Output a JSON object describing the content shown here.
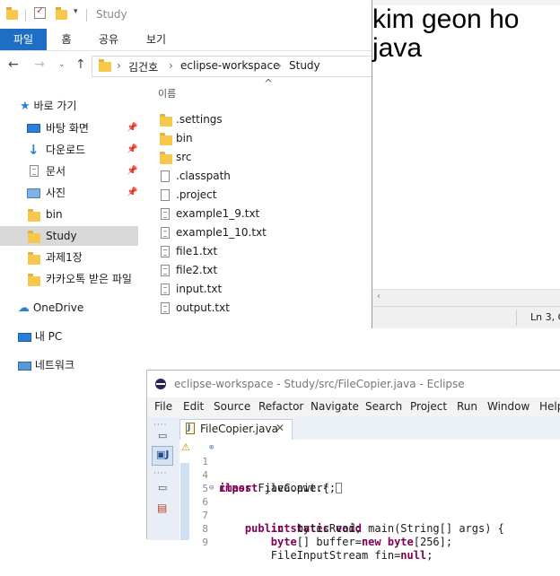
{
  "explorer": {
    "title": "Study",
    "ribbon_tabs": [
      "파일",
      "홈",
      "공유",
      "보기"
    ],
    "breadcrumb": [
      "김건호",
      "eclipse-workspace",
      "Study"
    ],
    "column_header": "이름",
    "quick_access_label": "바로 가기",
    "nav_items": [
      {
        "label": "바탕 화면",
        "icon": "desktop-icon",
        "pinned": true
      },
      {
        "label": "다운로드",
        "icon": "download-icon",
        "pinned": true
      },
      {
        "label": "문서",
        "icon": "documents-icon",
        "pinned": true
      },
      {
        "label": "사진",
        "icon": "pictures-icon",
        "pinned": true
      },
      {
        "label": "bin",
        "icon": "folder-icon",
        "pinned": false
      },
      {
        "label": "Study",
        "icon": "folder-icon",
        "pinned": false,
        "selected": true
      },
      {
        "label": "과제1장",
        "icon": "folder-icon",
        "pinned": false
      },
      {
        "label": "카카오톡 받은 파일",
        "icon": "folder-icon",
        "pinned": false
      }
    ],
    "onedrive_label": "OneDrive",
    "thispc_label": "내 PC",
    "network_label": "네트워크",
    "files": [
      {
        "name": ".settings",
        "type": "folder"
      },
      {
        "name": "bin",
        "type": "folder"
      },
      {
        "name": "src",
        "type": "folder"
      },
      {
        "name": ".classpath",
        "type": "file"
      },
      {
        "name": ".project",
        "type": "file"
      },
      {
        "name": "example1_9.txt",
        "type": "txt"
      },
      {
        "name": "example1_10.txt",
        "type": "txt"
      },
      {
        "name": "file1.txt",
        "type": "txt"
      },
      {
        "name": "file2.txt",
        "type": "txt"
      },
      {
        "name": "input.txt",
        "type": "txt"
      },
      {
        "name": "output.txt",
        "type": "txt"
      }
    ]
  },
  "notepad": {
    "content": "kim geon ho\njava",
    "status_position": "Ln 3, C"
  },
  "eclipse": {
    "title": "eclipse-workspace - Study/src/FileCopier.java - Eclipse",
    "menu": [
      "File",
      "Edit",
      "Source",
      "Refactor",
      "Navigate",
      "Search",
      "Project",
      "Run",
      "Window",
      "Help"
    ],
    "tab_label": "FileCopier.java",
    "code": [
      {
        "ln": "1",
        "segs": [
          {
            "t": "import",
            "k": true
          },
          {
            "t": " java.awt.*;",
            "k": false
          }
        ]
      },
      {
        "ln": "4",
        "segs": [
          {
            "t": "class",
            "k": true
          },
          {
            "t": " FileCopier{",
            "k": false
          }
        ]
      },
      {
        "ln": "5",
        "segs": []
      },
      {
        "ln": "6",
        "segs": [
          {
            "t": "    ",
            "k": false
          },
          {
            "t": "public static void",
            "k": true
          },
          {
            "t": " main(String[] args) {",
            "k": false
          }
        ]
      },
      {
        "ln": "7",
        "segs": [
          {
            "t": "        ",
            "k": false
          },
          {
            "t": "int",
            "k": true
          },
          {
            "t": " bytesRead;",
            "k": false
          }
        ]
      },
      {
        "ln": "8",
        "segs": [
          {
            "t": "        ",
            "k": false
          },
          {
            "t": "byte",
            "k": true
          },
          {
            "t": "[] buffer=",
            "k": false
          },
          {
            "t": "new byte",
            "k": true
          },
          {
            "t": "[256];",
            "k": false
          }
        ]
      },
      {
        "ln": "9",
        "segs": [
          {
            "t": "        FileInputStream fin=",
            "k": false
          },
          {
            "t": "null",
            "k": true
          },
          {
            "t": ";",
            "k": false
          }
        ]
      }
    ]
  }
}
